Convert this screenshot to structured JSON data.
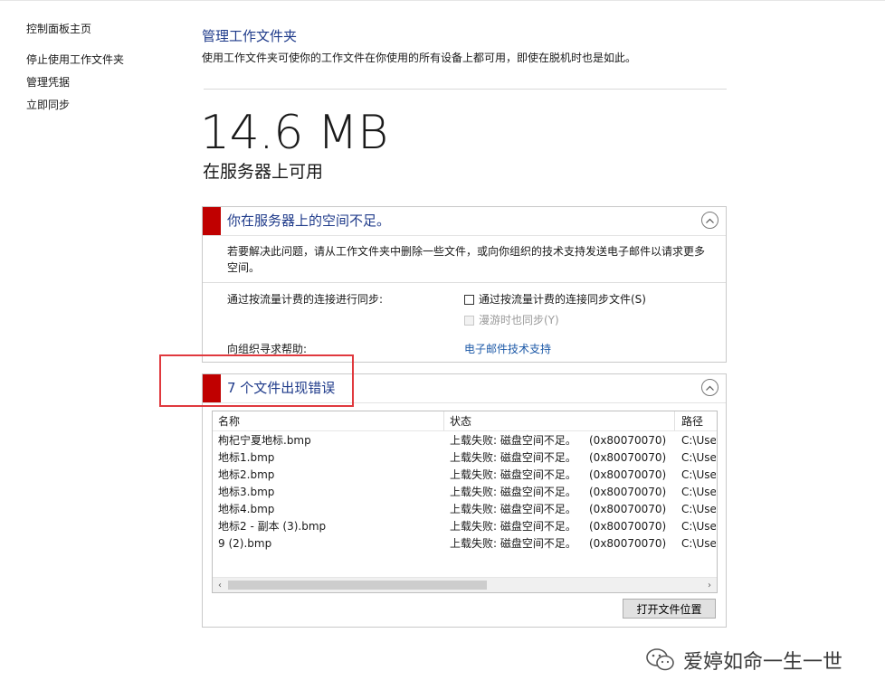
{
  "sidebar": {
    "items": [
      {
        "label": "控制面板主页"
      },
      {
        "label": "停止使用工作文件夹"
      },
      {
        "label": "管理凭据"
      },
      {
        "label": "立即同步"
      }
    ]
  },
  "header": {
    "title": "管理工作文件夹",
    "description": "使用工作文件夹可使你的工作文件在你使用的所有设备上都可用，即使在脱机时也是如此。"
  },
  "storage": {
    "size": "14.6 MB",
    "caption": "在服务器上可用"
  },
  "space_panel": {
    "title": "你在服务器上的空间不足。",
    "body": "若要解决此问题，请从工作文件夹中删除一些文件，或向你组织的技术支持发送电子邮件以请求更多空间。",
    "metered_label": "通过按流量计费的连接进行同步:",
    "metered_checkbox": "通过按流量计费的连接同步文件(S)",
    "roaming_checkbox": "漫游时也同步(Y)",
    "help_label": "向组织寻求帮助:",
    "email_link": "电子邮件技术支持"
  },
  "error_panel": {
    "title": "7 个文件出现错误",
    "columns": [
      "名称",
      "状态",
      "路径"
    ],
    "rows": [
      {
        "name": "枸杞宁夏地标.bmp",
        "status": "上载失败: 磁盘空间不足。",
        "code": "(0x80070070)",
        "path": "C:\\Users"
      },
      {
        "name": "地标1.bmp",
        "status": "上载失败: 磁盘空间不足。",
        "code": "(0x80070070)",
        "path": "C:\\Users"
      },
      {
        "name": "地标2.bmp",
        "status": "上载失败: 磁盘空间不足。",
        "code": "(0x80070070)",
        "path": "C:\\Users"
      },
      {
        "name": "地标3.bmp",
        "status": "上载失败: 磁盘空间不足。",
        "code": "(0x80070070)",
        "path": "C:\\Users"
      },
      {
        "name": "地标4.bmp",
        "status": "上载失败: 磁盘空间不足。",
        "code": "(0x80070070)",
        "path": "C:\\Users"
      },
      {
        "name": "地标2 - 副本 (3).bmp",
        "status": "上载失败: 磁盘空间不足。",
        "code": "(0x80070070)",
        "path": "C:\\Users"
      },
      {
        "name": "9 (2).bmp",
        "status": "上载失败: 磁盘空间不足。",
        "code": "(0x80070070)",
        "path": "C:\\Users"
      }
    ],
    "open_button": "打开文件位置"
  },
  "watermark": {
    "text": "爱婷如命一生一世"
  },
  "colors": {
    "accent_red": "#c00000",
    "title_blue": "#1e3a8a",
    "link_blue": "#1e5aa8",
    "highlight_border": "#e0393e"
  }
}
